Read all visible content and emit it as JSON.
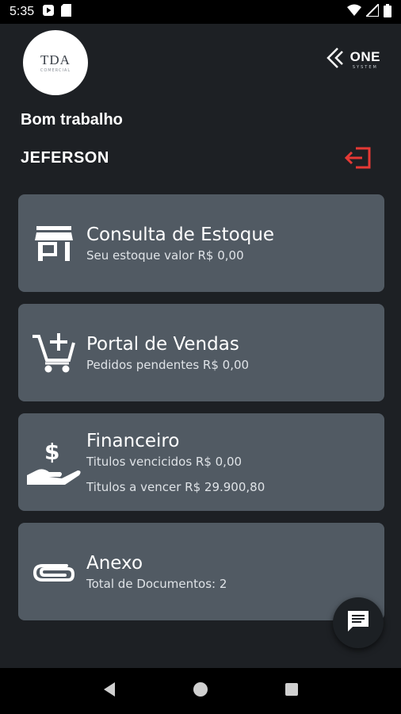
{
  "status_bar": {
    "time": "5:35",
    "icons_left": [
      "media-play-icon",
      "sd-card-icon"
    ],
    "icons_right": [
      "wifi-icon",
      "signal-icon",
      "battery-icon"
    ]
  },
  "header": {
    "logo_text": "TDA",
    "logo_subtext": "COMERCIAL",
    "brand_name": "ONE",
    "brand_sub": "SYSTEM",
    "greeting": "Bom trabalho",
    "username": "JEFERSON"
  },
  "cards": [
    {
      "title": "Consulta de Estoque",
      "subtitle": "Seu estoque valor R$ 0,00",
      "icon": "store-icon"
    },
    {
      "title": "Portal de Vendas",
      "subtitle": "Pedidos  pendentes R$ 0,00",
      "icon": "add-cart-icon"
    },
    {
      "title": "Financeiro",
      "subtitle": "Titulos vencicidos R$ 0,00",
      "subtitle2": "Titulos a vencer R$ 29.900,80",
      "icon": "money-hand-icon"
    },
    {
      "title": "Anexo",
      "subtitle": "Total de Documentos: 2",
      "icon": "paperclip-icon"
    }
  ],
  "colors": {
    "background": "#1d2024",
    "card": "#515a63",
    "logout": "#e53935",
    "text": "#ffffff"
  }
}
